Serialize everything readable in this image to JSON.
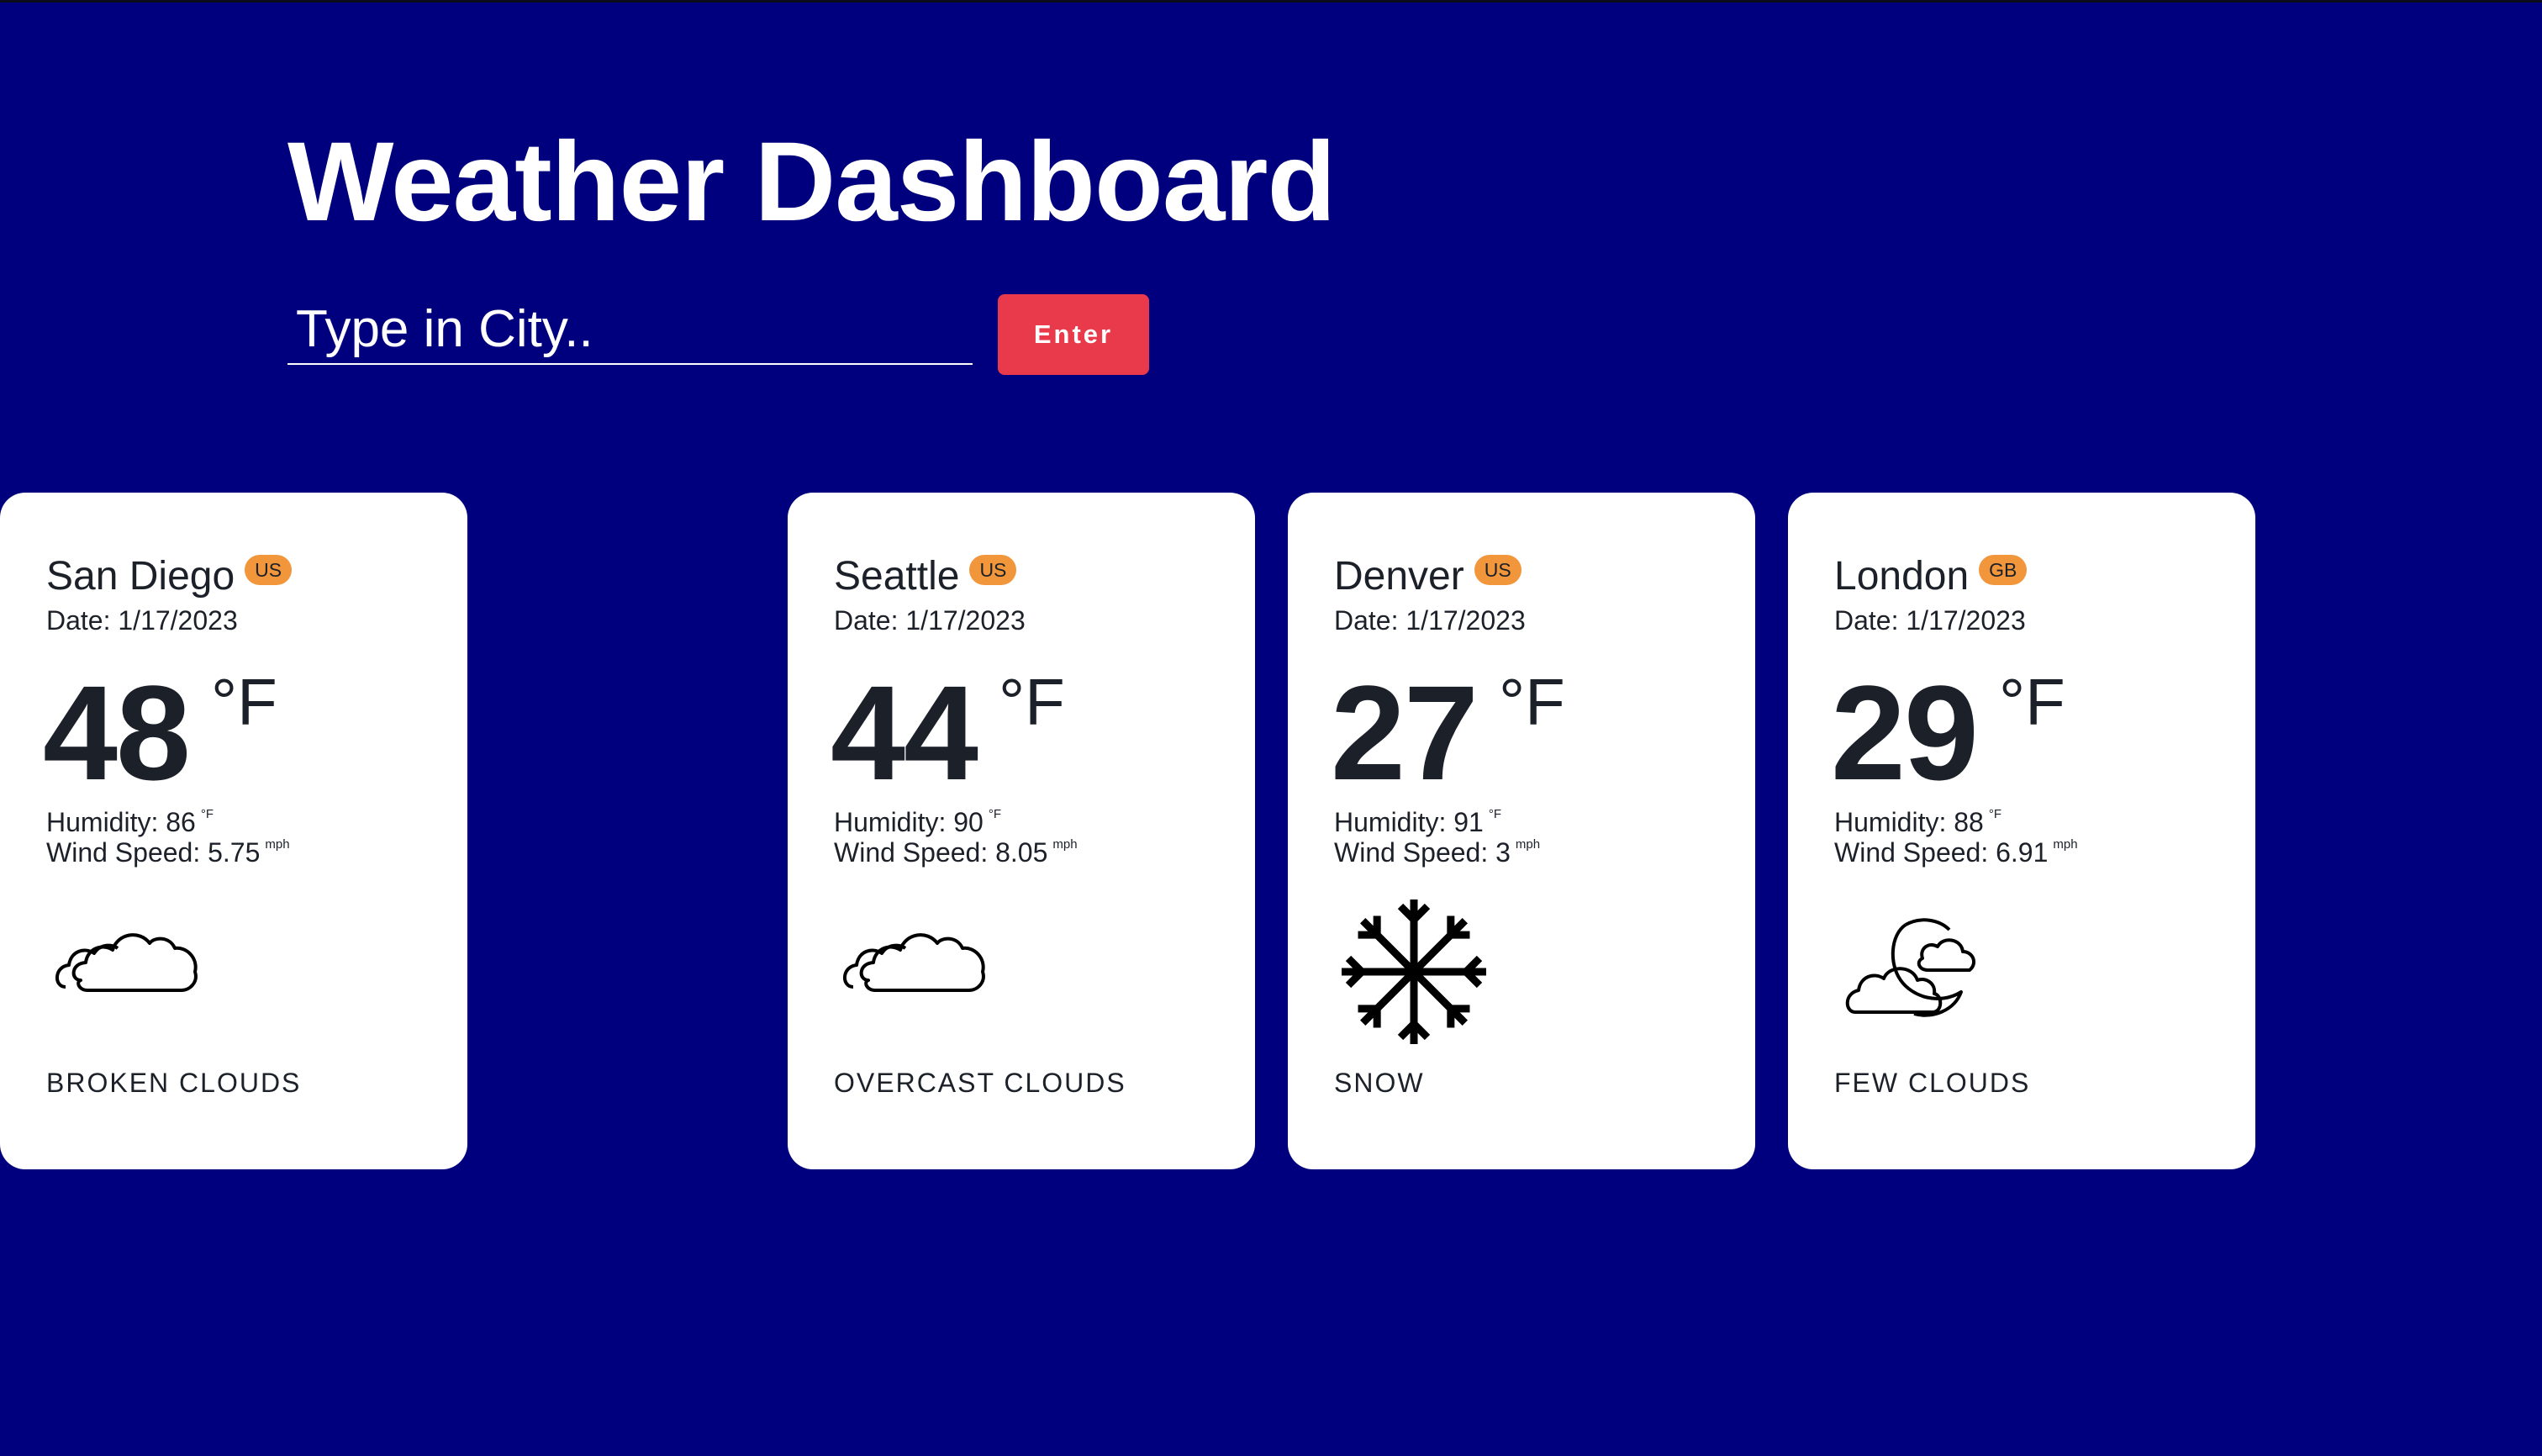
{
  "app": {
    "title": "Weather Dashboard"
  },
  "search": {
    "placeholder": "Type in City..",
    "value": "",
    "button_label": "Enter"
  },
  "colors": {
    "background": "#00007e",
    "card": "#ffffff",
    "accent_button": "#e83a4b",
    "badge": "#f2963c",
    "text": "#1c2029"
  },
  "cards": [
    {
      "city": "Seattle",
      "country": "US",
      "date": "Date: 1/17/2023",
      "temp": "44",
      "temp_unit": "°F",
      "humidity_label": "Humidity: 90",
      "humidity_unit": "°F",
      "wind_label": "Wind Speed: 8.05",
      "wind_unit": "mph",
      "icon": "cloud-icon",
      "condition": "OVERCAST CLOUDS"
    },
    {
      "city": "Denver",
      "country": "US",
      "date": "Date: 1/17/2023",
      "temp": "27",
      "temp_unit": "°F",
      "humidity_label": "Humidity: 91",
      "humidity_unit": "°F",
      "wind_label": "Wind Speed: 3",
      "wind_unit": "mph",
      "icon": "snowflake-icon",
      "condition": "SNOW"
    },
    {
      "city": "London",
      "country": "GB",
      "date": "Date: 1/17/2023",
      "temp": "29",
      "temp_unit": "°F",
      "humidity_label": "Humidity: 88",
      "humidity_unit": "°F",
      "wind_label": "Wind Speed: 6.91",
      "wind_unit": "mph",
      "icon": "moon-cloud-icon",
      "condition": "FEW CLOUDS"
    },
    {
      "city": "San Diego",
      "country": "US",
      "date": "Date: 1/17/2023",
      "temp": "48",
      "temp_unit": "°F",
      "humidity_label": "Humidity: 86",
      "humidity_unit": "°F",
      "wind_label": "Wind Speed: 5.75",
      "wind_unit": "mph",
      "icon": "cloud-icon",
      "condition": "BROKEN CLOUDS"
    }
  ]
}
